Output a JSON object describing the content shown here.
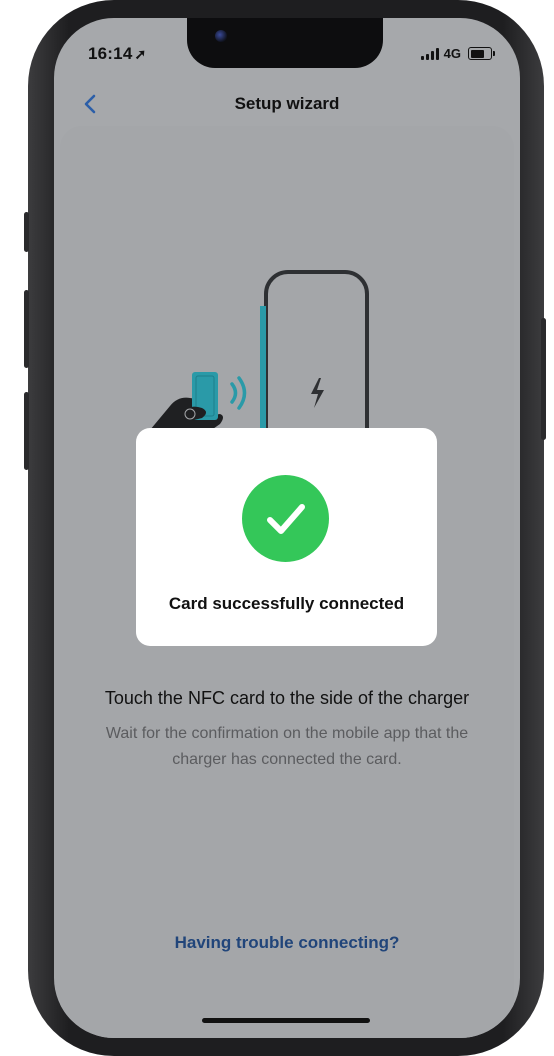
{
  "status_bar": {
    "time": "16:14",
    "location_icon": "location-arrow-icon",
    "network": "4G",
    "signal_icon": "signal-bars-icon",
    "battery_icon": "battery-icon"
  },
  "nav": {
    "back_icon": "chevron-left-icon",
    "title": "Setup wizard"
  },
  "illustration": {
    "description_icons": [
      "hand-holding-card-icon",
      "nfc-waves-icon",
      "charger-icon",
      "lightning-bolt-icon"
    ],
    "accent_color": "#2a9aa8"
  },
  "dialog": {
    "icon": "checkmark-circle-icon",
    "message": "Card successfully connected",
    "success_color": "#34c759"
  },
  "content": {
    "title": "Touch the NFC card to the side of the charger",
    "description": "Wait for the confirmation on the mobile app that the charger has connected the card."
  },
  "footer": {
    "help_link": "Having trouble connecting?",
    "link_color": "#21457a"
  }
}
